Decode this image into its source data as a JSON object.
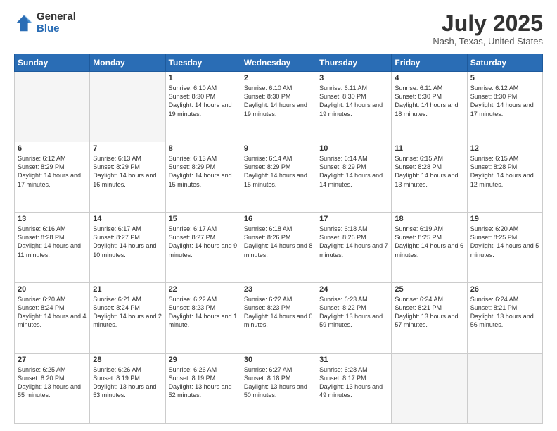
{
  "header": {
    "logo_general": "General",
    "logo_blue": "Blue",
    "month_title": "July 2025",
    "location": "Nash, Texas, United States"
  },
  "days_of_week": [
    "Sunday",
    "Monday",
    "Tuesday",
    "Wednesday",
    "Thursday",
    "Friday",
    "Saturday"
  ],
  "weeks": [
    [
      {
        "day": "",
        "sunrise": "",
        "sunset": "",
        "daylight": "",
        "empty": true
      },
      {
        "day": "",
        "sunrise": "",
        "sunset": "",
        "daylight": "",
        "empty": true
      },
      {
        "day": "1",
        "sunrise": "Sunrise: 6:10 AM",
        "sunset": "Sunset: 8:30 PM",
        "daylight": "Daylight: 14 hours and 19 minutes.",
        "empty": false
      },
      {
        "day": "2",
        "sunrise": "Sunrise: 6:10 AM",
        "sunset": "Sunset: 8:30 PM",
        "daylight": "Daylight: 14 hours and 19 minutes.",
        "empty": false
      },
      {
        "day": "3",
        "sunrise": "Sunrise: 6:11 AM",
        "sunset": "Sunset: 8:30 PM",
        "daylight": "Daylight: 14 hours and 19 minutes.",
        "empty": false
      },
      {
        "day": "4",
        "sunrise": "Sunrise: 6:11 AM",
        "sunset": "Sunset: 8:30 PM",
        "daylight": "Daylight: 14 hours and 18 minutes.",
        "empty": false
      },
      {
        "day": "5",
        "sunrise": "Sunrise: 6:12 AM",
        "sunset": "Sunset: 8:30 PM",
        "daylight": "Daylight: 14 hours and 17 minutes.",
        "empty": false
      }
    ],
    [
      {
        "day": "6",
        "sunrise": "Sunrise: 6:12 AM",
        "sunset": "Sunset: 8:29 PM",
        "daylight": "Daylight: 14 hours and 17 minutes.",
        "empty": false
      },
      {
        "day": "7",
        "sunrise": "Sunrise: 6:13 AM",
        "sunset": "Sunset: 8:29 PM",
        "daylight": "Daylight: 14 hours and 16 minutes.",
        "empty": false
      },
      {
        "day": "8",
        "sunrise": "Sunrise: 6:13 AM",
        "sunset": "Sunset: 8:29 PM",
        "daylight": "Daylight: 14 hours and 15 minutes.",
        "empty": false
      },
      {
        "day": "9",
        "sunrise": "Sunrise: 6:14 AM",
        "sunset": "Sunset: 8:29 PM",
        "daylight": "Daylight: 14 hours and 15 minutes.",
        "empty": false
      },
      {
        "day": "10",
        "sunrise": "Sunrise: 6:14 AM",
        "sunset": "Sunset: 8:29 PM",
        "daylight": "Daylight: 14 hours and 14 minutes.",
        "empty": false
      },
      {
        "day": "11",
        "sunrise": "Sunrise: 6:15 AM",
        "sunset": "Sunset: 8:28 PM",
        "daylight": "Daylight: 14 hours and 13 minutes.",
        "empty": false
      },
      {
        "day": "12",
        "sunrise": "Sunrise: 6:15 AM",
        "sunset": "Sunset: 8:28 PM",
        "daylight": "Daylight: 14 hours and 12 minutes.",
        "empty": false
      }
    ],
    [
      {
        "day": "13",
        "sunrise": "Sunrise: 6:16 AM",
        "sunset": "Sunset: 8:28 PM",
        "daylight": "Daylight: 14 hours and 11 minutes.",
        "empty": false
      },
      {
        "day": "14",
        "sunrise": "Sunrise: 6:17 AM",
        "sunset": "Sunset: 8:27 PM",
        "daylight": "Daylight: 14 hours and 10 minutes.",
        "empty": false
      },
      {
        "day": "15",
        "sunrise": "Sunrise: 6:17 AM",
        "sunset": "Sunset: 8:27 PM",
        "daylight": "Daylight: 14 hours and 9 minutes.",
        "empty": false
      },
      {
        "day": "16",
        "sunrise": "Sunrise: 6:18 AM",
        "sunset": "Sunset: 8:26 PM",
        "daylight": "Daylight: 14 hours and 8 minutes.",
        "empty": false
      },
      {
        "day": "17",
        "sunrise": "Sunrise: 6:18 AM",
        "sunset": "Sunset: 8:26 PM",
        "daylight": "Daylight: 14 hours and 7 minutes.",
        "empty": false
      },
      {
        "day": "18",
        "sunrise": "Sunrise: 6:19 AM",
        "sunset": "Sunset: 8:25 PM",
        "daylight": "Daylight: 14 hours and 6 minutes.",
        "empty": false
      },
      {
        "day": "19",
        "sunrise": "Sunrise: 6:20 AM",
        "sunset": "Sunset: 8:25 PM",
        "daylight": "Daylight: 14 hours and 5 minutes.",
        "empty": false
      }
    ],
    [
      {
        "day": "20",
        "sunrise": "Sunrise: 6:20 AM",
        "sunset": "Sunset: 8:24 PM",
        "daylight": "Daylight: 14 hours and 4 minutes.",
        "empty": false
      },
      {
        "day": "21",
        "sunrise": "Sunrise: 6:21 AM",
        "sunset": "Sunset: 8:24 PM",
        "daylight": "Daylight: 14 hours and 2 minutes.",
        "empty": false
      },
      {
        "day": "22",
        "sunrise": "Sunrise: 6:22 AM",
        "sunset": "Sunset: 8:23 PM",
        "daylight": "Daylight: 14 hours and 1 minute.",
        "empty": false
      },
      {
        "day": "23",
        "sunrise": "Sunrise: 6:22 AM",
        "sunset": "Sunset: 8:23 PM",
        "daylight": "Daylight: 14 hours and 0 minutes.",
        "empty": false
      },
      {
        "day": "24",
        "sunrise": "Sunrise: 6:23 AM",
        "sunset": "Sunset: 8:22 PM",
        "daylight": "Daylight: 13 hours and 59 minutes.",
        "empty": false
      },
      {
        "day": "25",
        "sunrise": "Sunrise: 6:24 AM",
        "sunset": "Sunset: 8:21 PM",
        "daylight": "Daylight: 13 hours and 57 minutes.",
        "empty": false
      },
      {
        "day": "26",
        "sunrise": "Sunrise: 6:24 AM",
        "sunset": "Sunset: 8:21 PM",
        "daylight": "Daylight: 13 hours and 56 minutes.",
        "empty": false
      }
    ],
    [
      {
        "day": "27",
        "sunrise": "Sunrise: 6:25 AM",
        "sunset": "Sunset: 8:20 PM",
        "daylight": "Daylight: 13 hours and 55 minutes.",
        "empty": false
      },
      {
        "day": "28",
        "sunrise": "Sunrise: 6:26 AM",
        "sunset": "Sunset: 8:19 PM",
        "daylight": "Daylight: 13 hours and 53 minutes.",
        "empty": false
      },
      {
        "day": "29",
        "sunrise": "Sunrise: 6:26 AM",
        "sunset": "Sunset: 8:19 PM",
        "daylight": "Daylight: 13 hours and 52 minutes.",
        "empty": false
      },
      {
        "day": "30",
        "sunrise": "Sunrise: 6:27 AM",
        "sunset": "Sunset: 8:18 PM",
        "daylight": "Daylight: 13 hours and 50 minutes.",
        "empty": false
      },
      {
        "day": "31",
        "sunrise": "Sunrise: 6:28 AM",
        "sunset": "Sunset: 8:17 PM",
        "daylight": "Daylight: 13 hours and 49 minutes.",
        "empty": false
      },
      {
        "day": "",
        "sunrise": "",
        "sunset": "",
        "daylight": "",
        "empty": true
      },
      {
        "day": "",
        "sunrise": "",
        "sunset": "",
        "daylight": "",
        "empty": true
      }
    ]
  ]
}
